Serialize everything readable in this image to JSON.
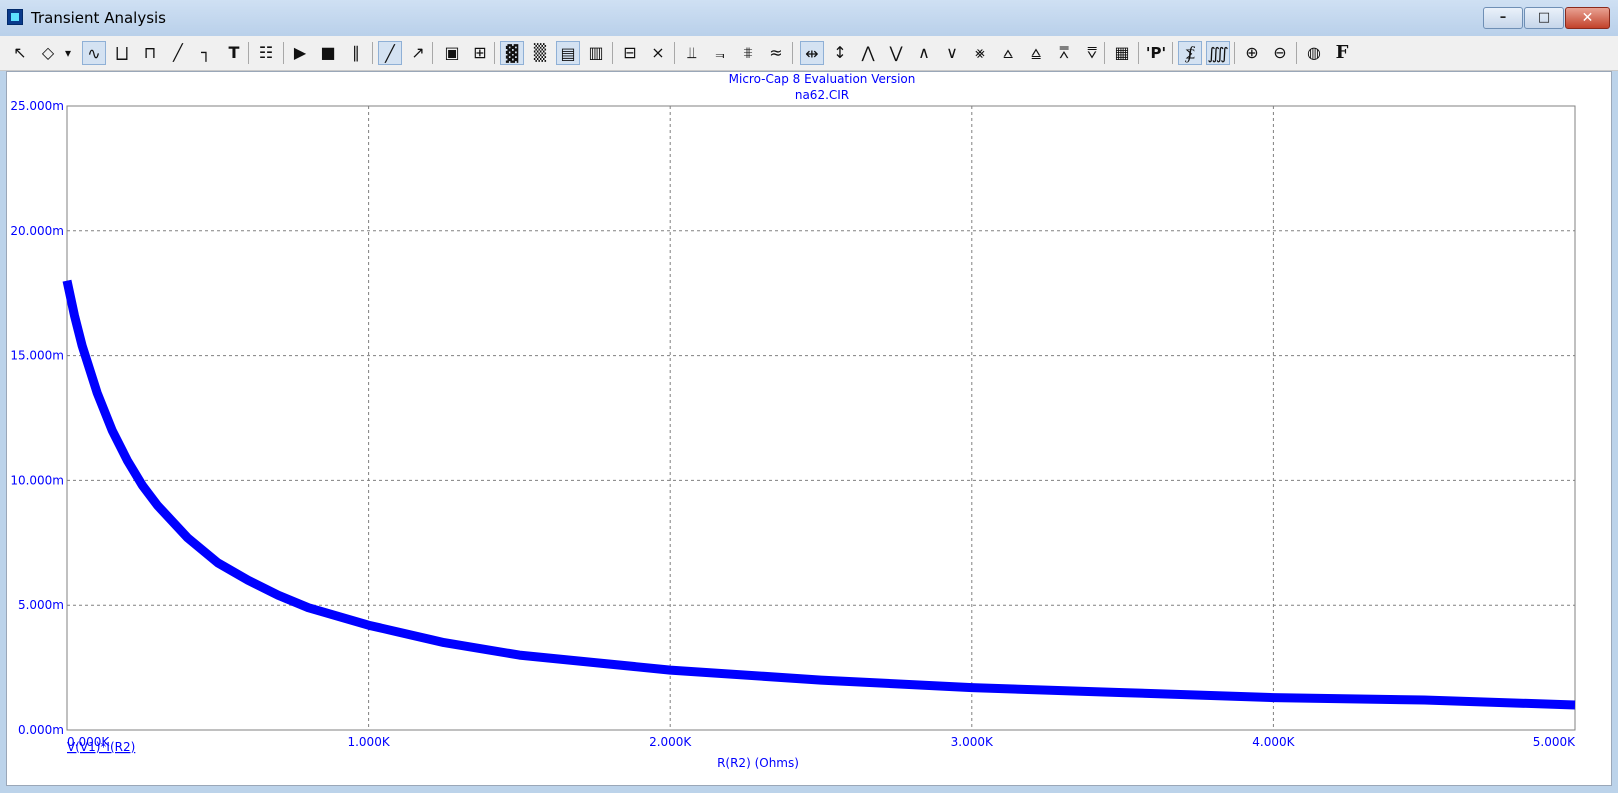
{
  "window": {
    "title": "Transient Analysis"
  },
  "toolbar": {
    "icons": [
      "select-arrow-icon",
      "component-select-icon",
      "dropdown-arrow-icon",
      "separate-analog-icon",
      "separate-digital-icon",
      "draw-box-icon",
      "draw-line-icon",
      "draw-polyline-icon",
      "text-icon",
      "properties-icon",
      "run-icon",
      "stop-icon",
      "pause-icon",
      "line-icon",
      "linear-scale-icon",
      "scale-box-icon",
      "grid-icon",
      "thin-grid-icon",
      "thick-grid-icon",
      "horizontal-grid-icon",
      "vertical-grid-icon",
      "axis-icon",
      "tracker-icon",
      "cursor-left-icon",
      "cursor-right-icon",
      "cursor-both-icon",
      "cursor-off-icon",
      "horizontal-cursor-icon",
      "vertical-cursor-icon",
      "peak-icon",
      "valley-icon",
      "high-icon",
      "low-icon",
      "inflection-icon",
      "global-high-icon",
      "global-low-icon",
      "top-icon",
      "bottom-icon",
      "numeric-table-icon",
      "point-tag-icon",
      "x-axis-scale-icon",
      "y-axis-scale-icon",
      "zoom-in-icon",
      "zoom-out-icon",
      "color-icon",
      "font-icon"
    ],
    "font_glyph": "F",
    "text_glyph": "T",
    "point_tag_glyph": "'P'"
  },
  "chart_data": {
    "type": "line",
    "title": "Micro-Cap 8 Evaluation Version",
    "subtitle": "na62.CIR",
    "xlabel": "R(R2) (Ohms)",
    "ylabel": "",
    "xlim": [
      0,
      5000
    ],
    "ylim": [
      0,
      0.025
    ],
    "x_ticks": [
      0,
      1000,
      2000,
      3000,
      4000,
      5000
    ],
    "x_tick_labels": [
      "0.000K",
      "1.000K",
      "2.000K",
      "3.000K",
      "4.000K",
      "5.000K"
    ],
    "y_ticks": [
      0,
      0.005,
      0.01,
      0.015,
      0.02,
      0.025
    ],
    "y_tick_labels": [
      "0.000m",
      "5.000m",
      "10.000m",
      "15.000m",
      "20.000m",
      "25.000m"
    ],
    "grid": true,
    "series": [
      {
        "name": "V(V1)*I(R2)",
        "color": "#0000ff",
        "x": [
          0,
          25,
          50,
          100,
          150,
          200,
          250,
          300,
          400,
          500,
          600,
          700,
          800,
          1000,
          1250,
          1500,
          1750,
          2000,
          2500,
          3000,
          3500,
          4000,
          4500,
          5000
        ],
        "y": [
          0.018,
          0.0166,
          0.0154,
          0.0135,
          0.012,
          0.0108,
          0.0098,
          0.009,
          0.0077,
          0.0067,
          0.006,
          0.0054,
          0.0049,
          0.0042,
          0.0035,
          0.003,
          0.0027,
          0.0024,
          0.002,
          0.0017,
          0.0015,
          0.0013,
          0.0012,
          0.001
        ]
      }
    ]
  }
}
